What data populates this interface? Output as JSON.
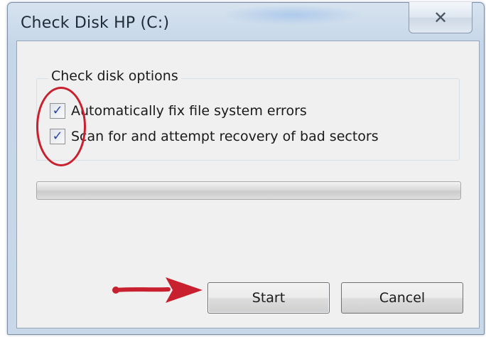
{
  "window": {
    "title": "Check Disk HP (C:)",
    "close_glyph": "✕"
  },
  "options_group": {
    "label": "Check disk options",
    "options": [
      {
        "label": "Automatically fix file system errors",
        "checked": true,
        "check_glyph": "✓"
      },
      {
        "label": "Scan for and attempt recovery of bad sectors",
        "checked": true,
        "check_glyph": "✓"
      }
    ]
  },
  "progress": {
    "value_percent": 0
  },
  "buttons": {
    "start_label": "Start",
    "cancel_label": "Cancel"
  },
  "annotations": {
    "highlight_color": "#c8202e",
    "ellipse_target": "option-checkboxes",
    "arrow_target": "start-button"
  },
  "icons": {
    "close": "close-icon",
    "check": "checkmark-icon",
    "arrow": "arrow-annotation-icon"
  }
}
